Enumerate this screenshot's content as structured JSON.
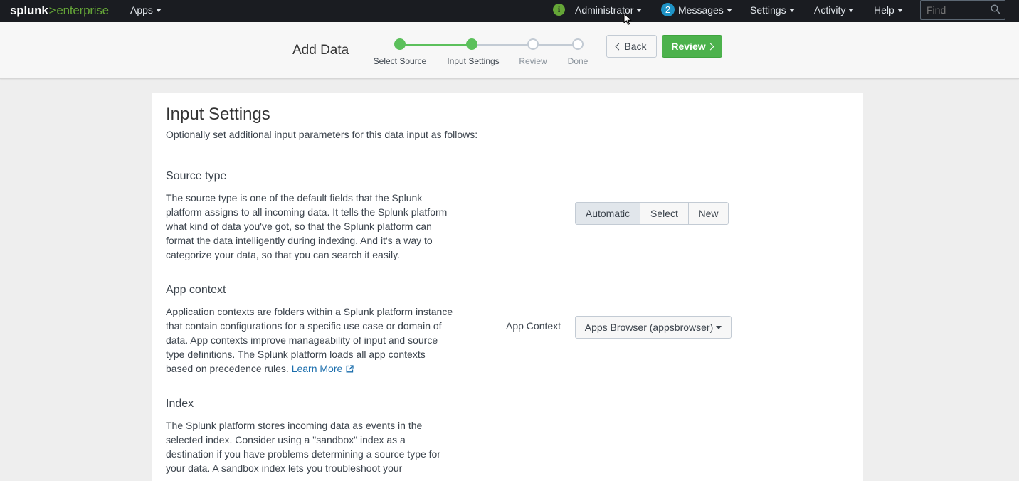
{
  "topbar": {
    "logo_splunk": "splunk",
    "logo_gt": ">",
    "logo_enterprise": "enterprise",
    "apps": "Apps",
    "info_glyph": "i",
    "administrator": "Administrator",
    "messages_count": "2",
    "messages": "Messages",
    "settings": "Settings",
    "activity": "Activity",
    "help": "Help",
    "find_placeholder": "Find"
  },
  "wizard": {
    "title": "Add Data",
    "steps": [
      {
        "label": "Select Source",
        "state": "done"
      },
      {
        "label": "Input Settings",
        "state": "done"
      },
      {
        "label": "Review",
        "state": "todo"
      },
      {
        "label": "Done",
        "state": "todo"
      }
    ],
    "back_label": "Back",
    "review_label": "Review"
  },
  "content": {
    "title": "Input Settings",
    "subtitle": "Optionally set additional input parameters for this data input as follows:",
    "source_type": {
      "title": "Source type",
      "lines": [
        "The source type is one of the default fields that the Splunk",
        "platform assigns to all incoming data. It tells the Splunk platform",
        "what kind of data you've got, so that the Splunk platform can",
        "format the data intelligently during indexing. And it's a way to",
        "categorize your data, so that you can search it easily."
      ],
      "options": [
        "Automatic",
        "Select",
        "New"
      ],
      "selected": "Automatic"
    },
    "app_context": {
      "title": "App context",
      "lines": [
        "Application contexts are folders within a Splunk platform instance",
        "that contain configurations for a specific use case or domain of",
        "data. App contexts improve manageability of input and source",
        "type definitions. The Splunk platform loads all app contexts",
        "based on precedence rules."
      ],
      "learn_more": "Learn More",
      "field_label": "App Context",
      "selected_value": "Apps Browser (appsbrowser)"
    },
    "index": {
      "title": "Index",
      "lines": [
        "The Splunk platform stores incoming data as events in the",
        "selected index. Consider using a \"sandbox\" index as a",
        "destination if you have problems determining a source type for",
        "your data. A sandbox index lets you troubleshoot your"
      ]
    }
  },
  "colors": {
    "accent_green": "#5cc05c",
    "link_blue": "#1a6dac",
    "topbar_bg": "#1a1c21"
  }
}
